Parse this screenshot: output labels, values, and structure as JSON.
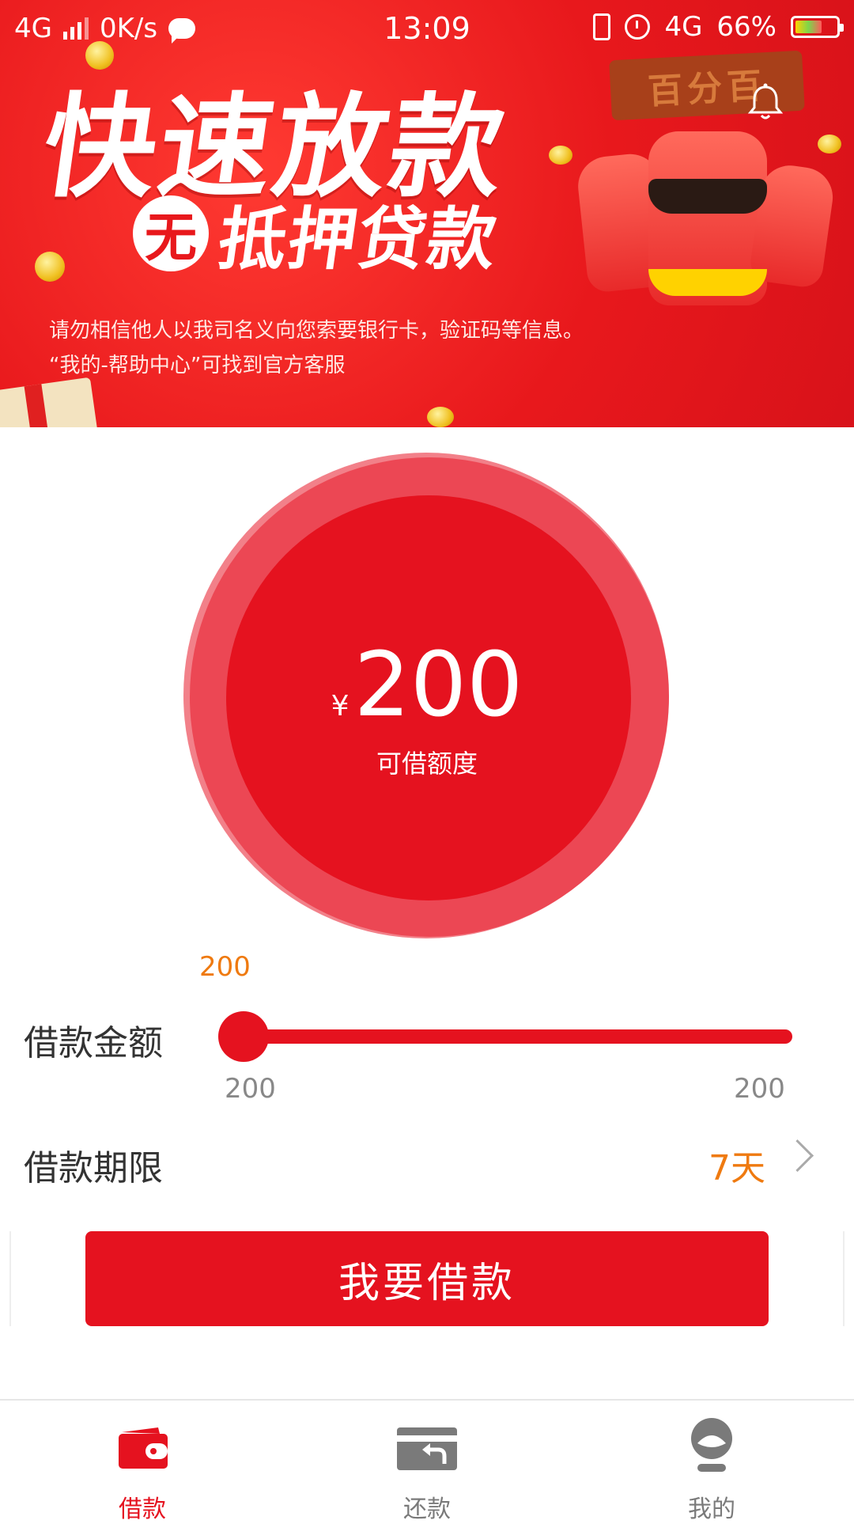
{
  "status_bar": {
    "network": "4G",
    "speed": "0K/s",
    "time": "13:09",
    "network_right": "4G",
    "battery": "66%"
  },
  "banner": {
    "headline": "快速放款",
    "subheadline_badge": "无",
    "subheadline": "抵押贷款",
    "brand_plate": "百分百",
    "notice_line1": "请勿相信他人以我司名义向您索要银行卡，验证码等信息。",
    "notice_line2": "“我的-帮助中心”可找到官方客服"
  },
  "credit": {
    "currency": "¥",
    "amount": "200",
    "label": "可借额度"
  },
  "loan_amount": {
    "label": "借款金额",
    "current_value": "200",
    "min": "200",
    "max": "200",
    "slider_fraction": 0
  },
  "loan_term": {
    "label": "借款期限",
    "value": "7天"
  },
  "action": {
    "button_label": "我要借款"
  },
  "tabs": [
    {
      "label": "借款",
      "icon": "wallet-icon",
      "active": true
    },
    {
      "label": "还款",
      "icon": "card-return-icon",
      "active": false
    },
    {
      "label": "我的",
      "icon": "profile-icon",
      "active": false
    }
  ],
  "colors": {
    "brand_red": "#e5121f",
    "accent_orange": "#ef7a10",
    "inactive_gray": "#7a7a7a"
  }
}
